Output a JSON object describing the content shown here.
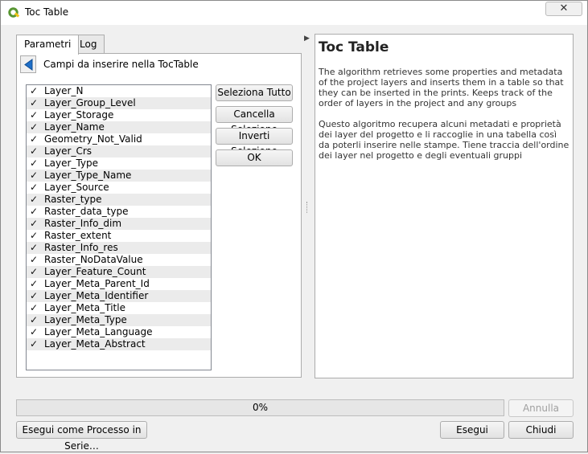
{
  "window": {
    "title": "Toc Table",
    "close_glyph": "✕"
  },
  "tabs": [
    {
      "label": "Parametri"
    },
    {
      "label": "Log"
    }
  ],
  "panel": {
    "title": "Campi da inserire nella TocTable"
  },
  "fields": [
    {
      "label": "Layer_N",
      "checked": true
    },
    {
      "label": "Layer_Group_Level",
      "checked": true
    },
    {
      "label": "Layer_Storage",
      "checked": true
    },
    {
      "label": "Layer_Name",
      "checked": true
    },
    {
      "label": "Geometry_Not_Valid",
      "checked": true
    },
    {
      "label": "Layer_Crs",
      "checked": true
    },
    {
      "label": "Layer_Type",
      "checked": true
    },
    {
      "label": "Layer_Type_Name",
      "checked": true
    },
    {
      "label": "Layer_Source",
      "checked": true
    },
    {
      "label": "Raster_type",
      "checked": true
    },
    {
      "label": "Raster_data_type",
      "checked": true
    },
    {
      "label": "Raster_Info_dim",
      "checked": true
    },
    {
      "label": "Raster_extent",
      "checked": true
    },
    {
      "label": "Raster_Info_res",
      "checked": true
    },
    {
      "label": "Raster_NoDataValue",
      "checked": true
    },
    {
      "label": "Layer_Feature_Count",
      "checked": true
    },
    {
      "label": "Layer_Meta_Parent_Id",
      "checked": true
    },
    {
      "label": "Layer_Meta_Identifier",
      "checked": true
    },
    {
      "label": "Layer_Meta_Title",
      "checked": true
    },
    {
      "label": "Layer_Meta_Type",
      "checked": true
    },
    {
      "label": "Layer_Meta_Language",
      "checked": true
    },
    {
      "label": "Layer_Meta_Abstract",
      "checked": true
    }
  ],
  "side_buttons": {
    "select_all": "Seleziona Tutto",
    "clear_selection": "Cancella Selezione",
    "invert_selection": "Inverti Selezione",
    "ok": "OK"
  },
  "help": {
    "title": "Toc Table",
    "paragraph_en": "The algorithm retrieves some properties and metadata of the project layers and inserts them in a table so that they can be inserted in the prints. Keeps track of the order of layers in the project and any groups",
    "paragraph_it": "Questo algoritmo recupera alcuni metadati e proprietà dei layer del progetto e li raccoglie in una tabella così da poterli inserire nelle stampe. Tiene traccia dell'ordine dei layer nel progetto e degli eventuali gruppi"
  },
  "progress": {
    "value": 0,
    "text": "0%"
  },
  "footer": {
    "cancel": "Annulla",
    "batch": "Esegui come Processo in Serie…",
    "run": "Esegui",
    "close": "Chiudi"
  },
  "colors": {
    "progress_fill": "#06b025",
    "accent": "#1e6fc9",
    "qgis_green": "#589632"
  },
  "icons": {
    "app": "qgis-logo-icon",
    "back": "back-arrow-icon",
    "splitter": "chevron-right-icon"
  }
}
